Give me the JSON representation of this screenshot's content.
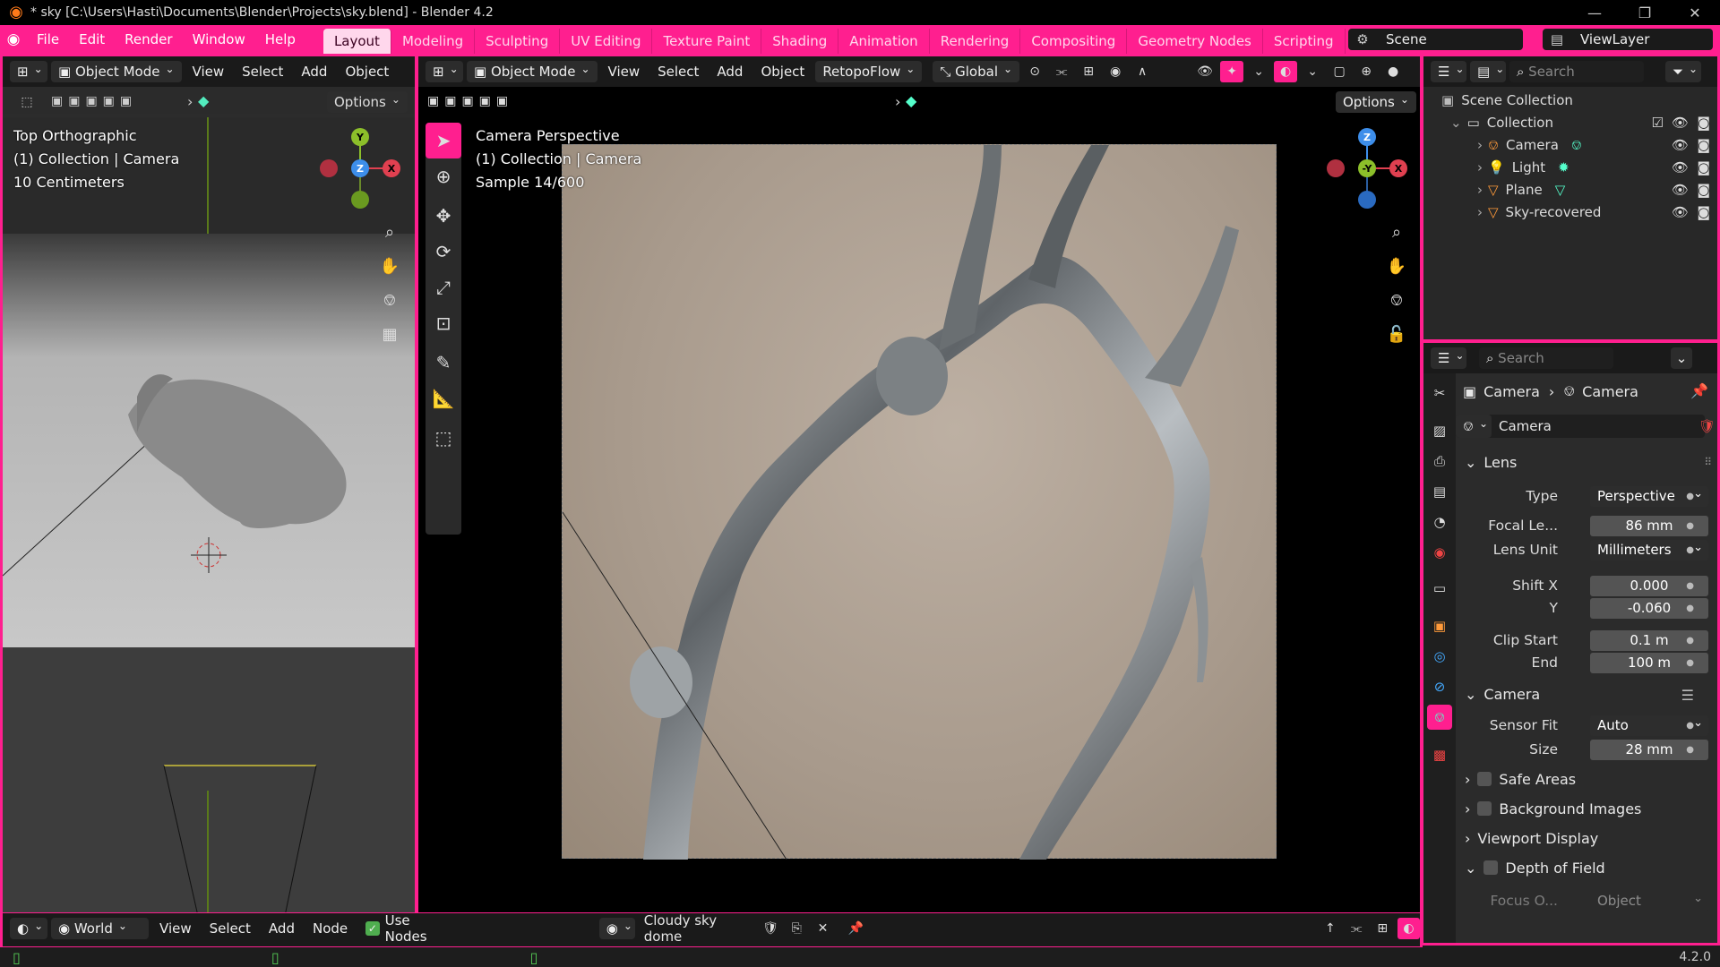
{
  "window": {
    "title": "* sky [C:\\Users\\Hasti\\Documents\\Blender\\Projects\\sky.blend] - Blender 4.2",
    "minimize": "—",
    "maximize": "❐",
    "close": "✕"
  },
  "menu": [
    "File",
    "Edit",
    "Render",
    "Window",
    "Help"
  ],
  "workspaces": [
    "Layout",
    "Modeling",
    "Sculpting",
    "UV Editing",
    "Texture Paint",
    "Shading",
    "Animation",
    "Rendering",
    "Compositing",
    "Geometry Nodes",
    "Scripting"
  ],
  "active_workspace": "Layout",
  "scene": "Scene",
  "view_layer": "ViewLayer",
  "left_view": {
    "mode": "Object Mode",
    "menus": [
      "View",
      "Select",
      "Add",
      "Object"
    ],
    "options": "Options",
    "overlay": [
      "Top Orthographic",
      "(1) Collection | Camera",
      "10 Centimeters"
    ]
  },
  "center_view": {
    "mode": "Object Mode",
    "menus": [
      "View",
      "Select",
      "Add",
      "Object"
    ],
    "addon": "RetopoFlow",
    "orientation": "Global",
    "options": "Options",
    "overlay": [
      "Camera Perspective",
      "(1) Collection | Camera",
      "Sample 14/600"
    ]
  },
  "outliner": {
    "search_placeholder": "Search",
    "root": "Scene Collection",
    "collection": "Collection",
    "items": [
      "Camera",
      "Light",
      "Plane",
      "Sky-recovered"
    ]
  },
  "properties": {
    "search_placeholder": "Search",
    "breadcrumb": [
      "Camera",
      "Camera"
    ],
    "datablock": "Camera",
    "lens_section": "Lens",
    "type_label": "Type",
    "type_value": "Perspective",
    "focal_label": "Focal Le...",
    "focal_value": "86 mm",
    "lens_unit_label": "Lens Unit",
    "lens_unit_value": "Millimeters",
    "shiftx_label": "Shift X",
    "shiftx_value": "0.000",
    "shifty_label": "Y",
    "shifty_value": "-0.060",
    "clip_start_label": "Clip Start",
    "clip_start_value": "0.1 m",
    "clip_end_label": "End",
    "clip_end_value": "100 m",
    "camera_section": "Camera",
    "sensor_fit_label": "Sensor Fit",
    "sensor_fit_value": "Auto",
    "size_label": "Size",
    "size_value": "28 mm",
    "safe_areas": "Safe Areas",
    "background_images": "Background Images",
    "viewport_display": "Viewport Display",
    "dof": "Depth of Field",
    "focus_label": "Focus O...",
    "focus_value": "Object"
  },
  "node_bar": {
    "world": "World",
    "menus": [
      "View",
      "Select",
      "Add",
      "Node"
    ],
    "use_nodes": "Use Nodes",
    "world_name": "Cloudy sky dome"
  },
  "status": {
    "version": "4.2.0"
  },
  "colors": {
    "accent": "#ff1f8f",
    "header": "#1a1a1a",
    "field": "#545454",
    "active_tab": "#ffd7ec"
  },
  "icons": [
    "blender-logo",
    "eye-icon",
    "camera-icon",
    "light-icon",
    "plane-icon",
    "zoom-icon",
    "hand-icon",
    "grid-icon",
    "lock-icon",
    "search-icon",
    "pin-icon"
  ]
}
